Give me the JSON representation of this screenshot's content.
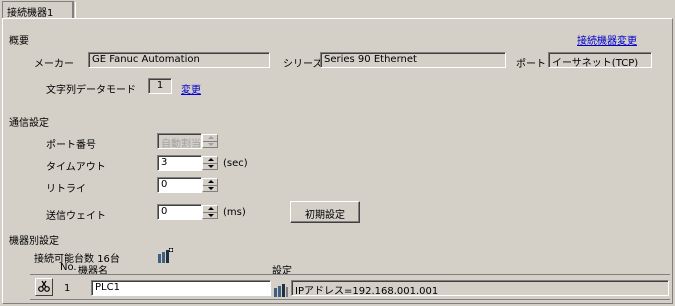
{
  "tab": {
    "label": "接続機器1"
  },
  "overview": {
    "heading": "概要",
    "change_device_link": "接続機器変更",
    "maker_label": "メーカー",
    "maker_value": "GE Fanuc Automation",
    "series_label": "シリーズ",
    "series_value": "Series 90 Ethernet",
    "port_label": "ポート",
    "port_value": "イーサネット(TCP)",
    "text_mode_label": "文字列データモード",
    "text_mode_value": "1",
    "text_mode_change": "変更"
  },
  "comm": {
    "heading": "通信設定",
    "port_no_label": "ポート番号",
    "port_no_value": "自動割当",
    "timeout_label": "タイムアウト",
    "timeout_value": "3",
    "timeout_unit": "(sec)",
    "retry_label": "リトライ",
    "retry_value": "0",
    "wait_label": "送信ウェイト",
    "wait_value": "0",
    "wait_unit": "(ms)",
    "init_button": "初期設定"
  },
  "device": {
    "heading": "機器別設定",
    "count_label": "接続可能台数",
    "count_value": "16台",
    "col_no": "No.",
    "col_name": "機器名",
    "col_settings": "設定",
    "rows": [
      {
        "no": "1",
        "name": "PLC1",
        "settings": "IPアドレス=192.168.001.001"
      }
    ]
  }
}
